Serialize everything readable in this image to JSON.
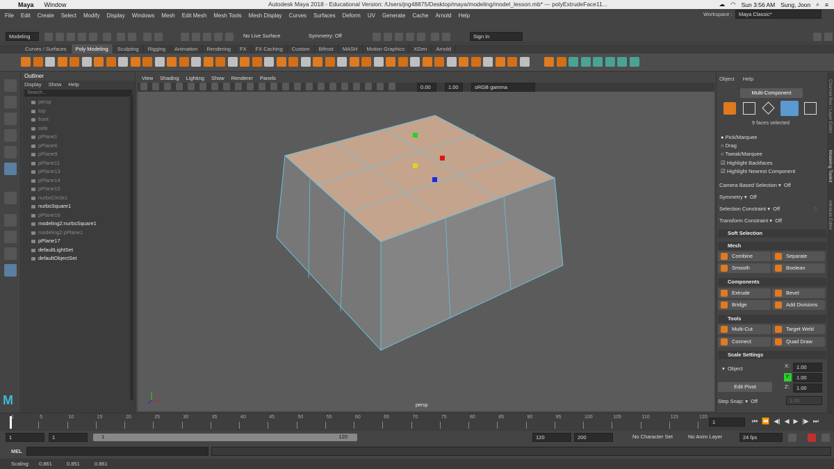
{
  "mac": {
    "app_name": "Maya",
    "window_menu": "Window",
    "title": "Autodesk Maya 2018 - Educational Version: /Users/jng48875/Desktop/maya/modeling/model_lesson.mb* --- polyExtrudeFace11...",
    "time": "Sun 3:56 AM",
    "user": "Sung, Joon"
  },
  "menu": [
    "File",
    "Edit",
    "Create",
    "Select",
    "Modify",
    "Display",
    "Windows",
    "Mesh",
    "Edit Mesh",
    "Mesh Tools",
    "Mesh Display",
    "Curves",
    "Surfaces",
    "Deform",
    "UV",
    "Generate",
    "Cache",
    "Arnold",
    "Help"
  ],
  "workspace": {
    "label": "Workspace :",
    "value": "Maya Classic*"
  },
  "status": {
    "mode": "Modeling",
    "live_surface": "No Live Surface",
    "symmetry": "Symmetry: Off",
    "sign_in": "Sign In"
  },
  "shelf_tabs": [
    "Curves / Surfaces",
    "Poly Modeling",
    "Sculpting",
    "Rigging",
    "Animation",
    "Rendering",
    "FX",
    "FX Caching",
    "Custom",
    "Bifrost",
    "MASH",
    "Motion Graphics",
    "XGen",
    "Arnold"
  ],
  "shelf_active": "Poly Modeling",
  "outliner": {
    "title": "Outliner",
    "menu": [
      "Display",
      "Show",
      "Help"
    ],
    "search": "Search...",
    "items": [
      {
        "label": "persp",
        "style": "dim"
      },
      {
        "label": "top",
        "style": "dim"
      },
      {
        "label": "front",
        "style": "dim"
      },
      {
        "label": "side",
        "style": "dim"
      },
      {
        "label": "pPlane1",
        "style": "dim"
      },
      {
        "label": "pPlane6",
        "style": "dim"
      },
      {
        "label": "pPlane9",
        "style": "dim"
      },
      {
        "label": "pPlane11",
        "style": "dim"
      },
      {
        "label": "pPlane13",
        "style": "dim"
      },
      {
        "label": "pPlane14",
        "style": "dim"
      },
      {
        "label": "pPlane15",
        "style": "dim"
      },
      {
        "label": "nurbsCircle1",
        "style": "dim"
      },
      {
        "label": "nurbsSquare1",
        "style": "bright"
      },
      {
        "label": "pPlane16",
        "style": "dim"
      },
      {
        "label": "modeling2:nurbsSquare1",
        "style": "bright"
      },
      {
        "label": "modeling2:pPlane1",
        "style": "dim"
      },
      {
        "label": "pPlane17",
        "style": "bright"
      },
      {
        "label": "defaultLightSet",
        "style": "bright"
      },
      {
        "label": "defaultObjectSet",
        "style": "bright"
      }
    ]
  },
  "viewport": {
    "menu": [
      "View",
      "Shading",
      "Lighting",
      "Show",
      "Renderer",
      "Panels"
    ],
    "exposure": "0.00",
    "gamma": "1.00",
    "color_space": "sRGB gamma",
    "camera_label": "persp"
  },
  "modeling_toolkit": {
    "tabs": [
      "Object",
      "Help"
    ],
    "multi_component": "Multi-Component",
    "selected_count": "9 faces selected",
    "pick_options": [
      "Pick/Marquee",
      "Drag",
      "Tweak/Marquee"
    ],
    "checks": [
      "Highlight Backfaces",
      "Highlight Nearest Component"
    ],
    "rows": [
      {
        "label": "Camera Based Selection",
        "value": "Off"
      },
      {
        "label": "Symmetry",
        "value": "Off"
      },
      {
        "label": "Selection Constraint",
        "value": "Off",
        "extra": "0"
      },
      {
        "label": "Transform Constraint",
        "value": "Off"
      }
    ],
    "soft_selection": "Soft Selection",
    "mesh_section": "Mesh",
    "mesh_buttons": [
      "Combine",
      "Separate",
      "Smooth",
      "Boolean"
    ],
    "components_section": "Components",
    "components_buttons": [
      "Extrude",
      "Bevel",
      "Bridge",
      "Add Divisions"
    ],
    "tools_section": "Tools",
    "tools_buttons": [
      "Multi-Cut",
      "Target Weld",
      "Connect",
      "Quad Draw"
    ],
    "scale_section": "Scale Settings",
    "scale_mode": "Object",
    "scale_x": "1.00",
    "scale_y": "1.00",
    "scale_z": "1.00",
    "x_label": "X:",
    "y_label": "Y:",
    "z_label": "Z:",
    "edit_pivot": "Edit Pivot",
    "step_snap_label": "Step Snap:",
    "step_snap_value": "Off",
    "step_snap_num": "1.00",
    "side_tabs": [
      "Channel Box / Layer Editor",
      "Modeling Toolkit",
      "Attribute Editor"
    ]
  },
  "timeline": {
    "ticks": [
      "1",
      "5",
      "10",
      "15",
      "20",
      "25",
      "30",
      "35",
      "40",
      "45",
      "50",
      "55",
      "60",
      "65",
      "70",
      "75",
      "80",
      "85",
      "90",
      "95",
      "100",
      "105",
      "110",
      "115",
      "120"
    ],
    "current_frame": "1",
    "start": "1",
    "inner_start": "1",
    "range_left": "1",
    "range_right": "120",
    "end": "120",
    "outer_end": "200",
    "character_set": "No Character Set",
    "anim_layer": "No Anim Layer",
    "fps": "24 fps"
  },
  "mel": {
    "label": "MEL"
  },
  "help_line": {
    "label": "Scaling:",
    "v1": "0.861",
    "v2": "0.851",
    "v3": "0.861"
  },
  "colors": {
    "accent": "#e07a1f",
    "selection": "#6ac0e0",
    "face_fill": "#c4a48c"
  }
}
